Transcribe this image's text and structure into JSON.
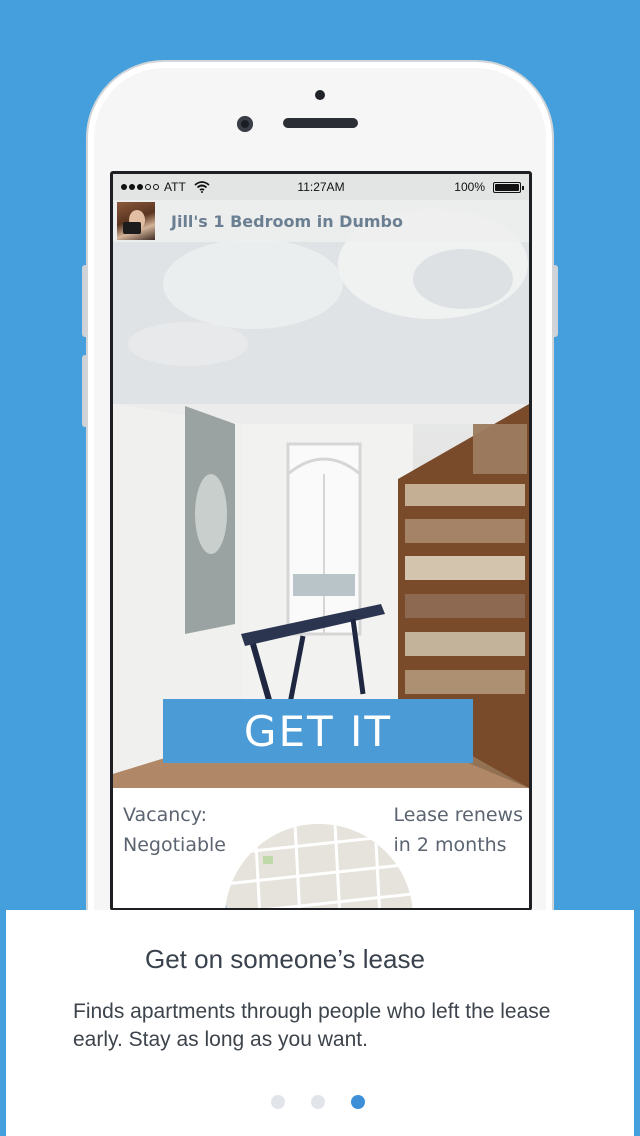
{
  "status_bar": {
    "carrier": "ATT",
    "time": "11:27AM",
    "battery_pct": "100%",
    "signal_bars": 3,
    "signal_total": 5
  },
  "listing": {
    "title": "Jill's 1 Bedroom in Dumbo",
    "cta_label": "GET IT",
    "vacancy_label": "Vacancy:",
    "vacancy_value": "Negotiable",
    "lease_label": "Lease renews",
    "lease_value": "in 2 months"
  },
  "onboarding": {
    "title": "Get on someone’s lease",
    "body": "Finds apartments through people who left the lease early. Stay as long as you want.",
    "page_count": 3,
    "current_page": 3
  },
  "colors": {
    "background": "#449fdc",
    "accent": "#4a9bd6",
    "active_dot": "#3d8fd7",
    "inactive_dot": "#e1e4e8"
  },
  "icons": [
    "signal-icon",
    "wifi-icon",
    "battery-icon",
    "avatar-photo",
    "map-thumbnail"
  ]
}
